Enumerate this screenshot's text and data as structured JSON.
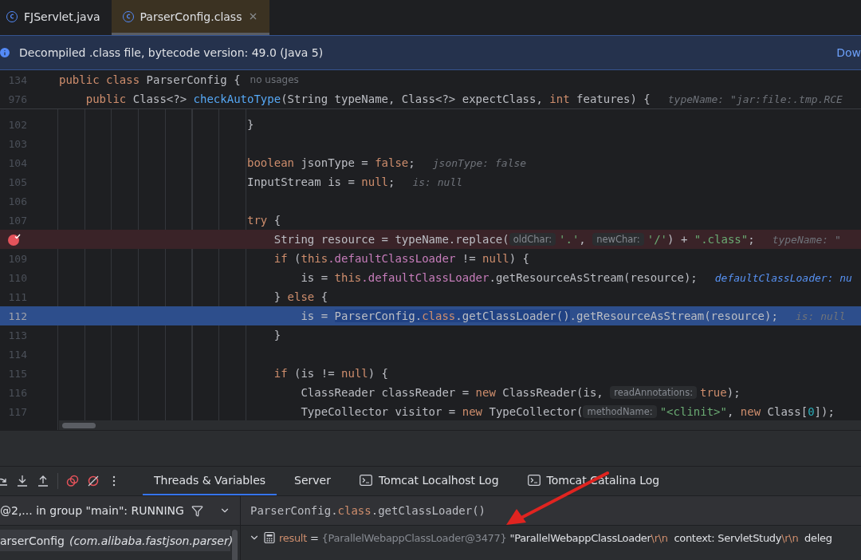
{
  "tabs": [
    {
      "label": "FJServlet.java",
      "selected": false,
      "closable": false
    },
    {
      "label": "ParserConfig.class",
      "selected": true,
      "closable": true
    }
  ],
  "banner": {
    "text": "Decompiled .class file, bytecode version: 49.0 (Java 5)",
    "link": "Dow"
  },
  "sticky_lines": [
    {
      "number": "134",
      "tokens": [
        {
          "t": "public class ",
          "kind": "keyword"
        },
        {
          "t": "ParserConfig {",
          "kind": "plain"
        },
        {
          "t": "no usages",
          "kind": "note"
        }
      ]
    },
    {
      "number": "976",
      "tokens": [
        {
          "t": "    public ",
          "kind": "keyword"
        },
        {
          "t": "Class<?> ",
          "kind": "plain"
        },
        {
          "t": "checkAutoType",
          "kind": "method"
        },
        {
          "t": "(String typeName, Class<?> expectClass, ",
          "kind": "plain"
        },
        {
          "t": "int ",
          "kind": "keyword"
        },
        {
          "t": "features) {",
          "kind": "plain"
        },
        {
          "t": "typeName: \"jar:file:.tmp.RCE",
          "kind": "value"
        }
      ]
    }
  ],
  "lines": [
    {
      "number": "102",
      "breakpoint": false,
      "current": false,
      "tokens": [
        {
          "t": "                            }",
          "kind": "plain"
        }
      ]
    },
    {
      "number": "103",
      "breakpoint": false,
      "current": false
    },
    {
      "number": "104",
      "breakpoint": false,
      "current": false,
      "tokens": [
        {
          "t": "                            boolean ",
          "kind": "keyword"
        },
        {
          "t": "jsonType = ",
          "kind": "plain"
        },
        {
          "t": "false",
          "kind": "keyword"
        },
        {
          "t": ";",
          "kind": "plain"
        },
        {
          "t": "jsonType: false",
          "kind": "value"
        }
      ]
    },
    {
      "number": "105",
      "breakpoint": false,
      "current": false,
      "tokens": [
        {
          "t": "                            InputStream is = ",
          "kind": "plain"
        },
        {
          "t": "null",
          "kind": "keyword"
        },
        {
          "t": ";",
          "kind": "plain"
        },
        {
          "t": "is: null",
          "kind": "value"
        }
      ]
    },
    {
      "number": "106",
      "breakpoint": false,
      "current": false
    },
    {
      "number": "107",
      "breakpoint": false,
      "current": false,
      "tokens": [
        {
          "t": "                            try ",
          "kind": "keyword"
        },
        {
          "t": "{",
          "kind": "plain"
        }
      ]
    },
    {
      "breakpoint": true,
      "current": false,
      "tokens": [
        {
          "t": "                                String resource = typeName.replace(",
          "kind": "plain"
        },
        {
          "t": "oldChar:",
          "kind": "hint"
        },
        {
          "t": "'.'",
          "kind": "string"
        },
        {
          "t": ", ",
          "kind": "plain"
        },
        {
          "t": "newChar:",
          "kind": "hint"
        },
        {
          "t": "'/'",
          "kind": "string"
        },
        {
          "t": ") + ",
          "kind": "plain"
        },
        {
          "t": "\".class\"",
          "kind": "string"
        },
        {
          "t": ";",
          "kind": "plain"
        },
        {
          "t": "typeName: \"",
          "kind": "value"
        }
      ]
    },
    {
      "number": "109",
      "breakpoint": false,
      "current": false,
      "tokens": [
        {
          "t": "                                if ",
          "kind": "keyword"
        },
        {
          "t": "(",
          "kind": "plain"
        },
        {
          "t": "this",
          "kind": "keyword"
        },
        {
          "t": ".defaultClassLoader",
          "kind": "field"
        },
        {
          "t": " != ",
          "kind": "plain"
        },
        {
          "t": "null",
          "kind": "keyword"
        },
        {
          "t": ") {",
          "kind": "plain"
        }
      ]
    },
    {
      "number": "110",
      "breakpoint": false,
      "current": false,
      "tokens": [
        {
          "t": "                                    is = ",
          "kind": "plain"
        },
        {
          "t": "this",
          "kind": "keyword"
        },
        {
          "t": ".defaultClassLoader",
          "kind": "field"
        },
        {
          "t": ".getResourceAsStream(resource);",
          "kind": "plain"
        },
        {
          "t": "defaultClassLoader: nu",
          "kind": "value_blue"
        }
      ]
    },
    {
      "number": "111",
      "breakpoint": false,
      "current": false,
      "tokens": [
        {
          "t": "                                } ",
          "kind": "plain"
        },
        {
          "t": "else ",
          "kind": "keyword"
        },
        {
          "t": "{",
          "kind": "plain"
        }
      ]
    },
    {
      "number": "112",
      "breakpoint": false,
      "current": true,
      "tokens": [
        {
          "t": "                                    is = ",
          "kind": "plain"
        },
        {
          "t": "ParserConfig.",
          "kind": "selected"
        },
        {
          "t": "class",
          "kind": "selected_keyword"
        },
        {
          "t": ".getClassLoader()",
          "kind": "selected"
        },
        {
          "t": ".getResourceAsStream(resource);",
          "kind": "plain"
        },
        {
          "t": "is: null",
          "kind": "value"
        }
      ]
    },
    {
      "number": "113",
      "breakpoint": false,
      "current": false,
      "tokens": [
        {
          "t": "                                }",
          "kind": "plain"
        }
      ]
    },
    {
      "number": "114",
      "breakpoint": false,
      "current": false
    },
    {
      "number": "115",
      "breakpoint": false,
      "current": false,
      "tokens": [
        {
          "t": "                                if ",
          "kind": "keyword"
        },
        {
          "t": "(is != ",
          "kind": "plain"
        },
        {
          "t": "null",
          "kind": "keyword"
        },
        {
          "t": ") {",
          "kind": "plain"
        }
      ]
    },
    {
      "number": "116",
      "breakpoint": false,
      "current": false,
      "tokens": [
        {
          "t": "                                    ClassReader classReader = ",
          "kind": "plain"
        },
        {
          "t": "new ",
          "kind": "keyword"
        },
        {
          "t": "ClassReader(is, ",
          "kind": "plain"
        },
        {
          "t": "readAnnotations:",
          "kind": "hint"
        },
        {
          "t": "true",
          "kind": "keyword"
        },
        {
          "t": ");",
          "kind": "plain"
        }
      ]
    },
    {
      "number": "117",
      "breakpoint": false,
      "current": false,
      "tokens": [
        {
          "t": "                                    TypeCollector visitor = ",
          "kind": "plain"
        },
        {
          "t": "new ",
          "kind": "keyword"
        },
        {
          "t": "TypeCollector(",
          "kind": "plain"
        },
        {
          "t": "methodName:",
          "kind": "hint"
        },
        {
          "t": "\"<clinit>\"",
          "kind": "string"
        },
        {
          "t": ", ",
          "kind": "plain"
        },
        {
          "t": "new ",
          "kind": "keyword"
        },
        {
          "t": "Class[",
          "kind": "plain"
        },
        {
          "t": "0",
          "kind": "number"
        },
        {
          "t": "]);",
          "kind": "plain"
        }
      ]
    }
  ],
  "debug": {
    "tabs": [
      {
        "label": "Threads & Variables",
        "selected": true,
        "kind": "plain"
      },
      {
        "label": "Server",
        "selected": false,
        "kind": "plain"
      },
      {
        "label": "Tomcat Localhost Log",
        "selected": false,
        "kind": "terminal"
      },
      {
        "label": "Tomcat Catalina Log",
        "selected": false,
        "kind": "terminal"
      }
    ],
    "thread": "@2,... in group \"main\": RUNNING",
    "frames": [
      {
        "method": "arserConfig",
        "location": "(com.alibaba.fastjson.parser)",
        "selected": true
      }
    ],
    "expression": [
      {
        "t": "ParserConfig.",
        "kind": "plain"
      },
      {
        "t": "class",
        "kind": "keyword"
      },
      {
        "t": ".getClassLoader()",
        "kind": "plain"
      }
    ],
    "variables": [
      {
        "expanded": true,
        "name": "result",
        "equals": "=",
        "type": "{ParallelWebappClassLoader@3477}",
        "value": [
          {
            "t": "\"ParallelWebappClassLoader",
            "kind": "plain"
          },
          {
            "t": "\\r\\n",
            "kind": "escape"
          },
          {
            "t": "  context: ServletStudy",
            "kind": "plain"
          },
          {
            "t": "\\r\\n",
            "kind": "escape"
          },
          {
            "t": "  deleg",
            "kind": "plain"
          }
        ]
      }
    ]
  }
}
